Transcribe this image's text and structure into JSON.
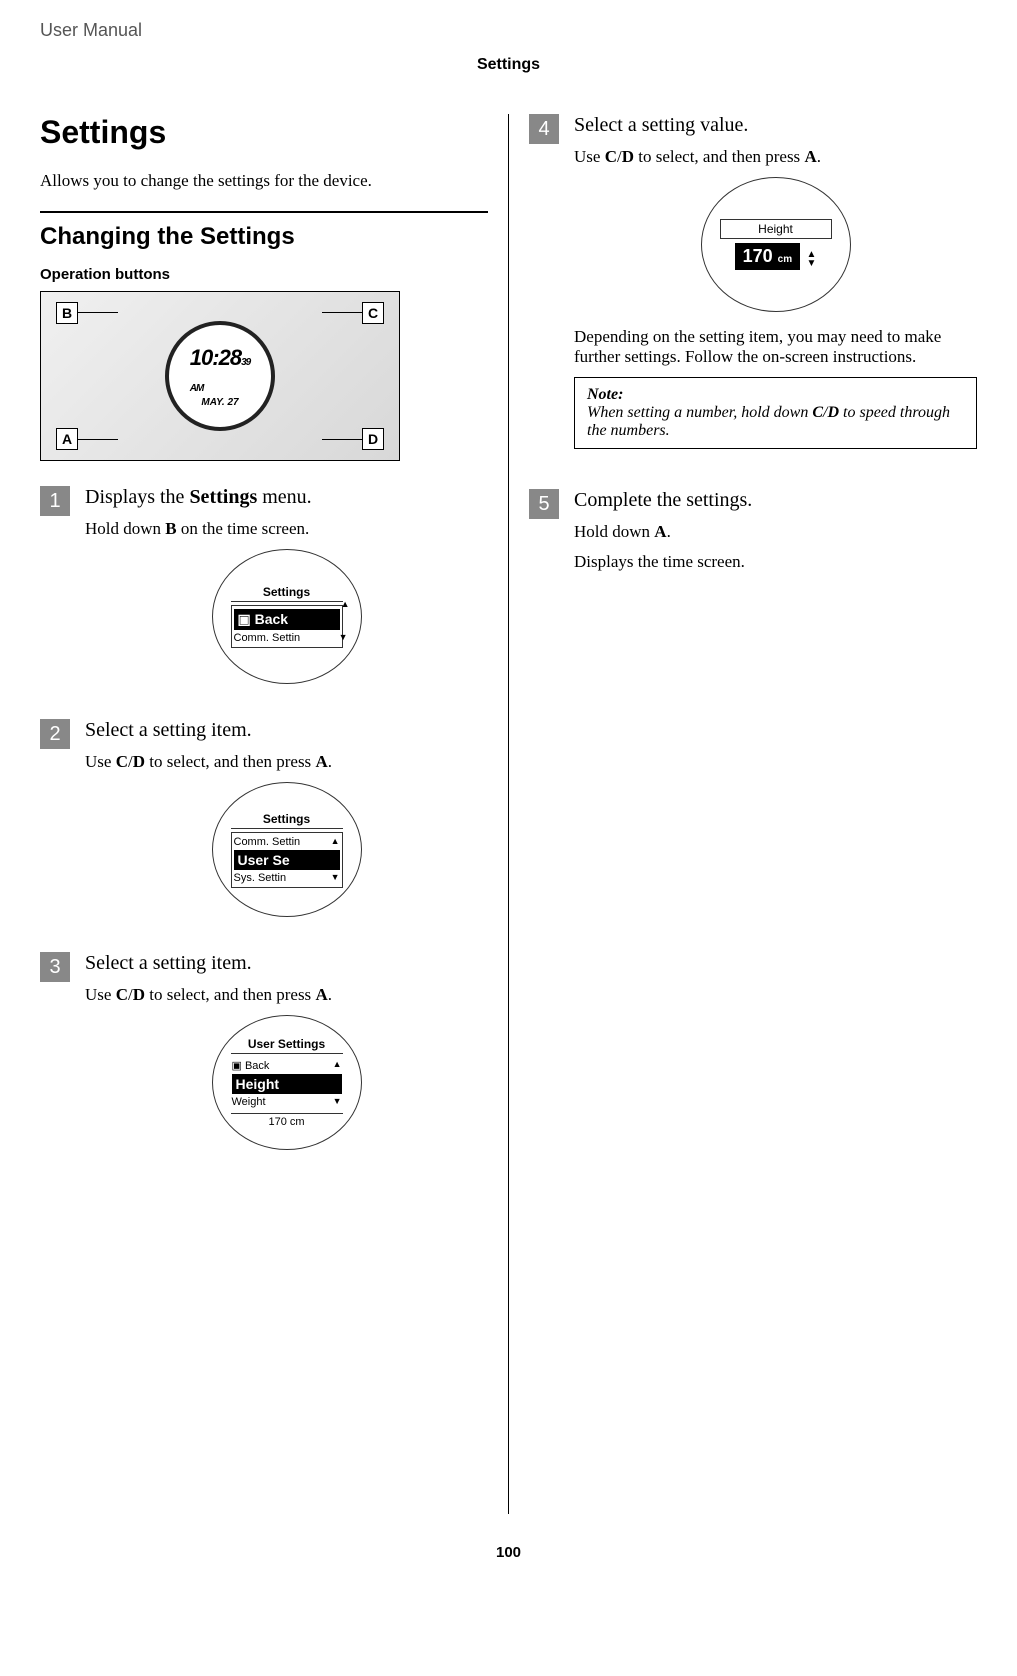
{
  "header": {
    "doc_title": "User Manual",
    "section": "Settings"
  },
  "main": {
    "title": "Settings",
    "intro": "Allows you to change the settings for the device.",
    "subsection": "Changing the Settings",
    "op_buttons_label": "Operation buttons",
    "watch": {
      "b": "B",
      "c": "C",
      "a": "A",
      "d": "D",
      "time": "10:28",
      "seconds": "39",
      "ampm": "AM",
      "date": "MAY. 27"
    },
    "steps": {
      "s1": {
        "num": "1",
        "title_pre": "Displays the ",
        "title_bold": "Settings",
        "title_post": " menu.",
        "text_pre": "Hold down ",
        "text_bold": "B",
        "text_post": " on the time screen.",
        "screen": {
          "header": "Settings",
          "row1": "▣ Back",
          "row2": "Comm. Settin"
        }
      },
      "s2": {
        "num": "2",
        "title": "Select a setting item.",
        "text_pre": "Use ",
        "text_b1": "C",
        "text_mid1": "/",
        "text_b2": "D",
        "text_mid2": " to select, and then press ",
        "text_b3": "A",
        "text_post": ".",
        "screen": {
          "header": "Settings",
          "row_top": "Comm. Settin",
          "row_sel": "User Se",
          "row_bot": "Sys. Settin"
        }
      },
      "s3": {
        "num": "3",
        "title": "Select a setting item.",
        "text_pre": "Use ",
        "text_b1": "C",
        "text_mid1": "/",
        "text_b2": "D",
        "text_mid2": " to select, and then press ",
        "text_b3": "A",
        "text_post": ".",
        "screen": {
          "header": "User Settings",
          "row_top": "▣ Back",
          "row_sel": "Height",
          "row_bot": "Weight",
          "footer": "170 cm"
        }
      },
      "s4": {
        "num": "4",
        "title": "Select a setting value.",
        "text_pre": "Use ",
        "text_b1": "C",
        "text_mid1": "/",
        "text_b2": "D",
        "text_mid2": " to select, and then press ",
        "text_b3": "A",
        "text_post": ".",
        "screen": {
          "header": "Height",
          "value": "170",
          "unit": "cm"
        },
        "para": "Depending on the setting item, you may need to make further settings. Follow the on-screen instructions.",
        "note_label": "Note:",
        "note_pre": "When setting a number, hold down ",
        "note_b1": "C",
        "note_mid": "/",
        "note_b2": "D",
        "note_post": " to speed through the numbers."
      },
      "s5": {
        "num": "5",
        "title": "Complete the settings.",
        "text_pre": "Hold down ",
        "text_b1": "A",
        "text_post": ".",
        "para": "Displays the time screen."
      }
    }
  },
  "page_number": "100"
}
